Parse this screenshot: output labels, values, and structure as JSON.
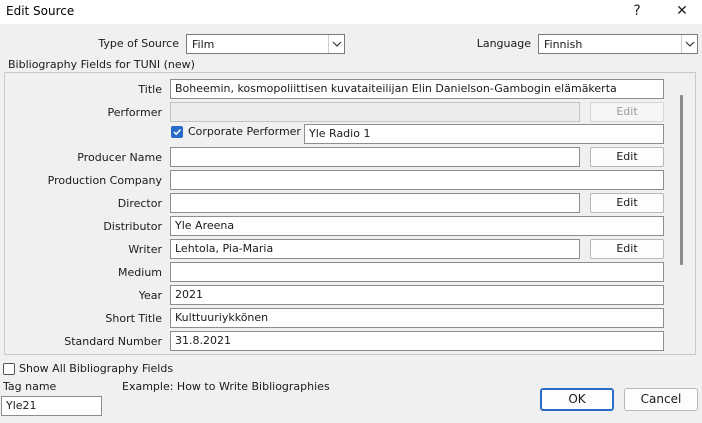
{
  "window": {
    "title": "Edit Source",
    "help_label": "?",
    "close_label": "✕"
  },
  "top": {
    "type_label": "Type of Source",
    "type_value": "Film",
    "language_label": "Language",
    "language_value": "Finnish"
  },
  "group_label": "Bibliography Fields for TUNI (new)",
  "fields": {
    "title": {
      "label": "Title",
      "value": "Boheemin, kosmopoliittisen kuvataiteilijan Elin Danielson-Gambogin elämäkerta"
    },
    "performer": {
      "label": "Performer",
      "value": "",
      "edit": "Edit"
    },
    "corporate": {
      "label": "Corporate Performer",
      "value": "Yle Radio 1",
      "checked": true
    },
    "producer": {
      "label": "Producer Name",
      "value": "",
      "edit": "Edit"
    },
    "production_company": {
      "label": "Production Company",
      "value": ""
    },
    "director": {
      "label": "Director",
      "value": "",
      "edit": "Edit"
    },
    "distributor": {
      "label": "Distributor",
      "value": "Yle Areena"
    },
    "writer": {
      "label": "Writer",
      "value": "Lehtola, Pia-Maria",
      "edit": "Edit"
    },
    "medium": {
      "label": "Medium",
      "value": ""
    },
    "year": {
      "label": "Year",
      "value": "2021"
    },
    "short_title": {
      "label": "Short Title",
      "value": "Kulttuuriykkönen"
    },
    "standard_number": {
      "label": "Standard Number",
      "value": "31.8.2021"
    }
  },
  "bottom": {
    "show_all_label": "Show All Bibliography Fields",
    "tag_label": "Tag name",
    "tag_value": "Yle21",
    "example": "Example: How to Write Bibliographies",
    "ok": "OK",
    "cancel": "Cancel"
  }
}
